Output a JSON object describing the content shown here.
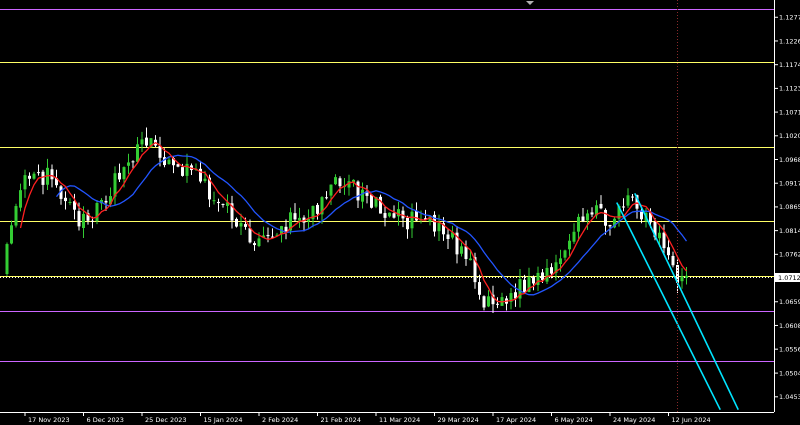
{
  "colors": {
    "background": "#000000",
    "bull_candle": "#33cc33",
    "bear_candle": "#ffffff",
    "ma_fast": "#ff2020",
    "ma_slow": "#2255ff",
    "support_resistance": "#ffff66",
    "outer_levels": "#cc66ff",
    "channel": "#00e5ff",
    "current_price_line": "#ffffff",
    "cursor_line": "#8b2a2a",
    "axis_text": "#ffffff"
  },
  "chart_data": {
    "type": "candlestick",
    "title": "",
    "xlabel": "",
    "ylabel": "",
    "ylim": [
      1.042,
      1.1315
    ],
    "grid": false,
    "y_ticks": [
      "1.12775",
      "1.12260",
      "1.11745",
      "1.11230",
      "1.10715",
      "1.10200",
      "1.09685",
      "1.09170",
      "1.08655",
      "1.08140",
      "1.07625",
      "1.06595",
      "1.06080",
      "1.05565",
      "1.05045",
      "1.04530"
    ],
    "current_price_label": "1.07123",
    "current_price": 1.07123,
    "x_ticks": [
      "17 Nov 2023",
      "6 Dec 2023",
      "25 Dec 2023",
      "15 Jan 2024",
      "2 Feb 2024",
      "21 Feb 2024",
      "11 Mar 2024",
      "29 Mar 2024",
      "17 Apr 2024",
      "6 May 2024",
      "24 May 2024",
      "12 Jun 2024"
    ],
    "x_tick_bar_index": [
      5,
      18,
      31,
      44,
      57,
      70,
      83,
      96,
      109,
      122,
      135,
      148
    ],
    "bar_count": 171,
    "horizontal_levels": [
      {
        "price": 1.1295,
        "kind": "outer"
      },
      {
        "price": 1.118,
        "kind": "key"
      },
      {
        "price": 1.0995,
        "kind": "key"
      },
      {
        "price": 1.0836,
        "kind": "key"
      },
      {
        "price": 1.0715,
        "kind": "key"
      },
      {
        "price": 1.064,
        "kind": "outer"
      },
      {
        "price": 1.053,
        "kind": "outer"
      }
    ],
    "cursor_bar_index": 150,
    "anchor_closes": [
      [
        0,
        1.074
      ],
      [
        5,
        1.092
      ],
      [
        10,
        1.093
      ],
      [
        14,
        1.087
      ],
      [
        19,
        1.082
      ],
      [
        24,
        1.091
      ],
      [
        29,
        1.098
      ],
      [
        33,
        1.101
      ],
      [
        38,
        1.094
      ],
      [
        42,
        1.095
      ],
      [
        47,
        1.088
      ],
      [
        52,
        1.084
      ],
      [
        56,
        1.079
      ],
      [
        60,
        1.079
      ],
      [
        64,
        1.084
      ],
      [
        70,
        1.085
      ],
      [
        75,
        1.093
      ],
      [
        79,
        1.09
      ],
      [
        84,
        1.086
      ],
      [
        88,
        1.084
      ],
      [
        94,
        1.083
      ],
      [
        99,
        1.08
      ],
      [
        103,
        1.076
      ],
      [
        107,
        1.065
      ],
      [
        111,
        1.066
      ],
      [
        115,
        1.069
      ],
      [
        120,
        1.072
      ],
      [
        124,
        1.076
      ],
      [
        128,
        1.085
      ],
      [
        132,
        1.085
      ],
      [
        136,
        1.084
      ],
      [
        140,
        1.088
      ],
      [
        144,
        1.082
      ],
      [
        148,
        1.077
      ],
      [
        150,
        1.072
      ],
      [
        152,
        1.071
      ]
    ],
    "channel": {
      "upper_line": [
        [
          140.5,
          1.0895
        ],
        [
          163.5,
          1.0425
        ]
      ],
      "lower_line": [
        [
          136.5,
          1.0875
        ],
        [
          159.5,
          1.0425
        ]
      ]
    },
    "ma_periods": [
      5,
      13
    ]
  }
}
